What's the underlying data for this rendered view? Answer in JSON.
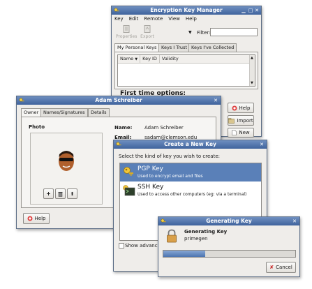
{
  "ekm": {
    "title": "Encryption Key Manager",
    "menu": [
      "Key",
      "Edit",
      "Remote",
      "View",
      "Help"
    ],
    "toolbar": {
      "properties": "Properties",
      "export": "Export",
      "filter_label": "Filter:",
      "filter_value": ""
    },
    "tabs": [
      "My Personal Keys",
      "Keys I Trust",
      "Keys I've Collected"
    ],
    "columns": [
      "Name",
      "Key ID",
      "Validity"
    ],
    "first_time": "First time options:",
    "buttons": {
      "help": "Help",
      "import": "Import",
      "new": "New"
    }
  },
  "owner": {
    "title": "Adam Schreiber",
    "tabs": [
      "Owner",
      "Names/Signatures",
      "Details"
    ],
    "photo_label": "Photo",
    "name_label": "Name:",
    "name_value": "Adam Schreiber",
    "email_label": "Email:",
    "email_value": "sadam@clemson.edu",
    "help": "Help"
  },
  "create": {
    "title": "Create a New Key",
    "prompt": "Select the kind of key you wish to create:",
    "options": [
      {
        "title": "PGP Key",
        "desc": "Used to encrypt email and files"
      },
      {
        "title": "SSH Key",
        "desc": "Used to access other computers (eg: via a terminal)"
      }
    ],
    "show_advanced": "Show advanced"
  },
  "generating": {
    "title": "Generating Key",
    "heading": "Generating Key",
    "key_name": "primegen",
    "progress": 0.32,
    "cancel": "Cancel"
  },
  "colors": {
    "title_bar": "#4a6ca5",
    "selection": "#5a80b8",
    "window_bg": "#efedea"
  }
}
